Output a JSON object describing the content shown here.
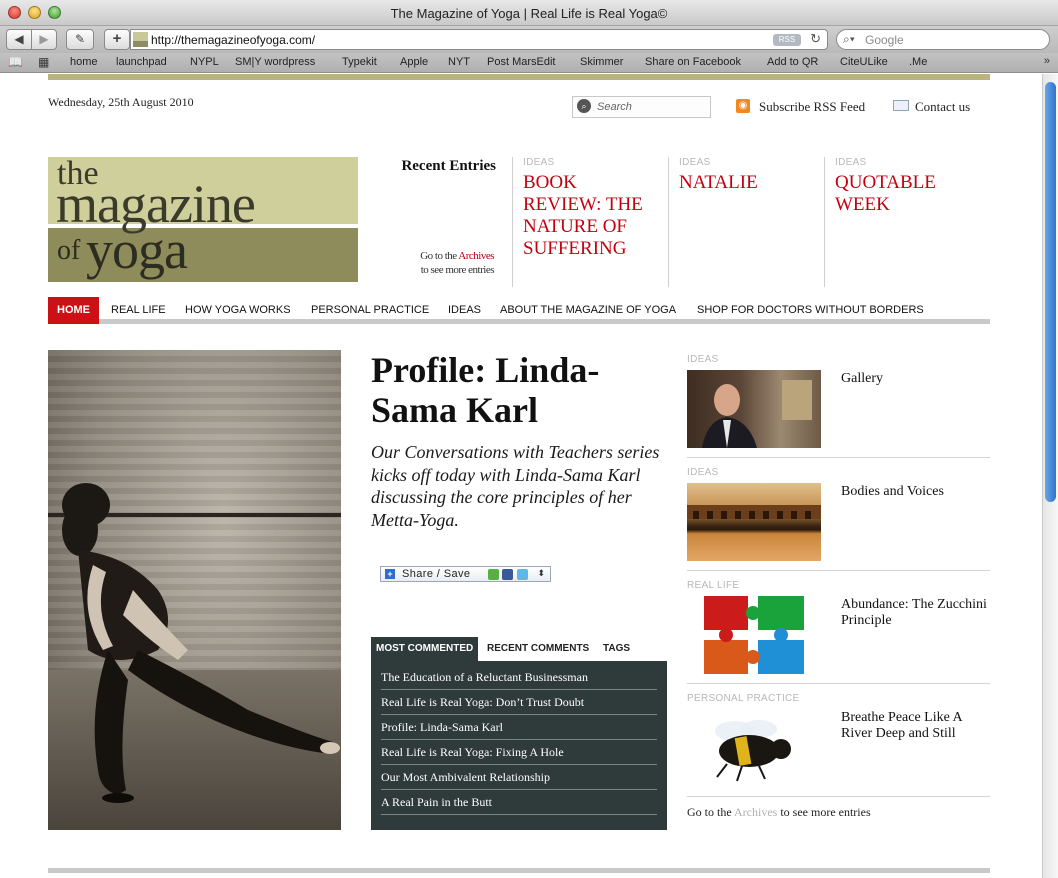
{
  "window": {
    "title": "The Magazine of Yoga | Real Life is Real Yoga©"
  },
  "toolbar": {
    "url": "http://themagazineofyoga.com/",
    "rss_badge": "RSS",
    "search_placeholder": "Google"
  },
  "bookmarks": [
    "home",
    "launchpad",
    "NYPL",
    "SM|Y wordpress",
    "Typekit",
    "Apple",
    "NYT",
    "Post MarsEdit",
    "Skimmer",
    "Share on Facebook",
    "Add to QR",
    "CiteULike",
    ".Me"
  ],
  "header": {
    "date": "Wednesday, 25th August 2010",
    "search_placeholder": "Search",
    "rss_label": "Subscribe RSS Feed",
    "contact_label": "Contact us"
  },
  "logo": {
    "the": "the",
    "magazine": "magazine",
    "of": "of",
    "yoga": "yoga"
  },
  "recent": {
    "heading": "Recent Entries",
    "archives_prefix": "Go to the ",
    "archives_link": "Archives",
    "archives_suffix": "to see more entries",
    "entries": [
      {
        "category": "IDEAS",
        "title": "BOOK REVIEW: THE NATURE OF SUFFERING"
      },
      {
        "category": "IDEAS",
        "title": "NATALIE"
      },
      {
        "category": "IDEAS",
        "title": "QUOTABLE WEEK"
      }
    ]
  },
  "nav": [
    "HOME",
    "REAL LIFE",
    "HOW YOGA WORKS",
    "PERSONAL PRACTICE",
    "IDEAS",
    "ABOUT THE MAGAZINE OF YOGA",
    "SHOP FOR DOCTORS WITHOUT BORDERS"
  ],
  "article": {
    "title": "Profile: Linda-Sama Karl",
    "dek": "Our Conversations with Teachers series kicks off today with Linda-Sama Karl discussing the core principles of her Metta-Yoga.",
    "share_label": "Share / Save"
  },
  "tabs": [
    "MOST COMMENTED",
    "RECENT COMMENTS",
    "TAGS"
  ],
  "most_commented": [
    "The Education of a Reluctant Businessman",
    "Real Life is Real Yoga: Don’t Trust Doubt",
    "Profile: Linda-Sama Karl",
    "Real Life is Real Yoga: Fixing A Hole",
    "Our Most Ambivalent Relationship",
    "A Real Pain in the Butt"
  ],
  "sidebar": {
    "items": [
      {
        "category": "IDEAS",
        "title": "Gallery"
      },
      {
        "category": "IDEAS",
        "title": "Bodies and Voices"
      },
      {
        "category": "REAL LIFE",
        "title": "Abundance: The Zucchini Principle"
      },
      {
        "category": "PERSONAL PRACTICE",
        "title": "Breathe Peace Like A River Deep and Still"
      }
    ],
    "archives_prefix": "Go to the ",
    "archives_link": "Archives",
    "archives_suffix": " to see more entries"
  },
  "colors": {
    "accent_red": "#cc1016",
    "headline_red": "#c4000e",
    "logo_light": "#cfcf9c",
    "logo_dark": "#8e8c5b",
    "comment_bg": "#2f3a3a"
  }
}
